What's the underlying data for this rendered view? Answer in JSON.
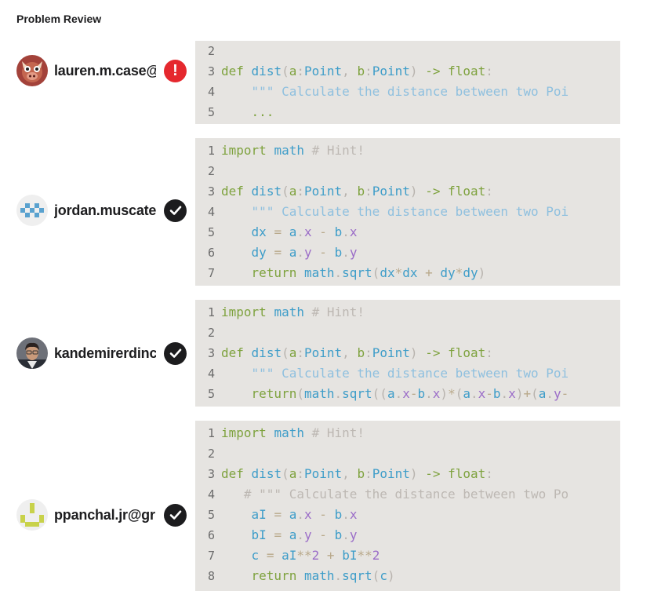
{
  "page": {
    "title": "Problem Review"
  },
  "colors": {
    "code_bg": "#e6e4e1",
    "ok": "#1c1c1e",
    "error": "#e5282e"
  },
  "submissions": [
    {
      "user": "lauren.m.case@",
      "status": "error",
      "status_icon": "exclamation-icon",
      "code_lines": [
        {
          "n": "2",
          "text": ""
        },
        {
          "n": "3",
          "text": "def dist(a:Point, b:Point) -> float:"
        },
        {
          "n": "4",
          "text": "    \"\"\" Calculate the distance between two Poi"
        },
        {
          "n": "5",
          "text": "    ..."
        }
      ]
    },
    {
      "user": "jordan.muscate",
      "status": "ok",
      "status_icon": "checkmark-icon",
      "code_lines": [
        {
          "n": "1",
          "text": "import math # Hint!"
        },
        {
          "n": "2",
          "text": ""
        },
        {
          "n": "3",
          "text": "def dist(a:Point, b:Point) -> float:"
        },
        {
          "n": "4",
          "text": "    \"\"\" Calculate the distance between two Poi"
        },
        {
          "n": "5",
          "text": "    dx = a.x - b.x"
        },
        {
          "n": "6",
          "text": "    dy = a.y - b.y"
        },
        {
          "n": "7",
          "text": "    return math.sqrt(dx*dx + dy*dy)"
        }
      ]
    },
    {
      "user": "kandemirerdinc",
      "status": "ok",
      "status_icon": "checkmark-icon",
      "code_lines": [
        {
          "n": "1",
          "text": "import math # Hint!"
        },
        {
          "n": "2",
          "text": ""
        },
        {
          "n": "3",
          "text": "def dist(a:Point, b:Point) -> float:"
        },
        {
          "n": "4",
          "text": "    \"\"\" Calculate the distance between two Poi"
        },
        {
          "n": "5",
          "text": "    return(math.sqrt((a.x-b.x)*(a.x-b.x)+(a.y-"
        }
      ]
    },
    {
      "user": "ppanchal.jr@gr",
      "status": "ok",
      "status_icon": "checkmark-icon",
      "code_lines": [
        {
          "n": "1",
          "text": "import math # Hint!"
        },
        {
          "n": "2",
          "text": ""
        },
        {
          "n": "3",
          "text": "def dist(a:Point, b:Point) -> float:"
        },
        {
          "n": "4",
          "text": "   # \"\"\" Calculate the distance between two Po"
        },
        {
          "n": "5",
          "text": "    aI = a.x - b.x"
        },
        {
          "n": "6",
          "text": "    bI = a.y - b.y"
        },
        {
          "n": "7",
          "text": "    c = aI**2 + bI**2"
        },
        {
          "n": "8",
          "text": "    return math.sqrt(c)"
        }
      ]
    }
  ]
}
